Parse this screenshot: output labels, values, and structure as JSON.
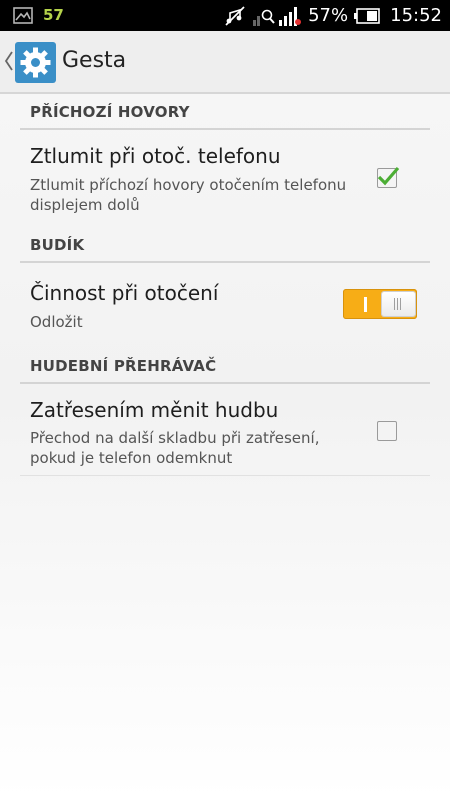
{
  "status_bar": {
    "notification_count": "57",
    "battery_percent": "57%",
    "time": "15:52",
    "icons": [
      "gallery-icon",
      "mute-icon",
      "signal-search-icon",
      "signal-strength-icon",
      "battery-icon"
    ]
  },
  "action_bar": {
    "title": "Gesta",
    "icon": "settings-gear-icon",
    "accent_color": "#3a8fc7"
  },
  "sections": [
    {
      "header": "PŘÍCHOZÍ HOVORY",
      "items": [
        {
          "title": "Ztlumit při otoč. telefonu",
          "summary": "Ztlumit příchozí hovory otočením telefonu displejem dolů",
          "control": "checkbox",
          "checked": true
        }
      ]
    },
    {
      "header": "BUDÍK",
      "items": [
        {
          "title": "Činnost při otočení",
          "summary": "Odložit",
          "control": "toggle",
          "on": true,
          "accent_color": "#f7ad16"
        }
      ]
    },
    {
      "header": "HUDEBNÍ PŘEHRÁVAČ",
      "items": [
        {
          "title": "Zatřesením měnit hudbu",
          "summary": "Přechod na další skladbu při zatřesení, pokud je telefon odemknut",
          "control": "checkbox",
          "checked": false
        }
      ]
    }
  ]
}
